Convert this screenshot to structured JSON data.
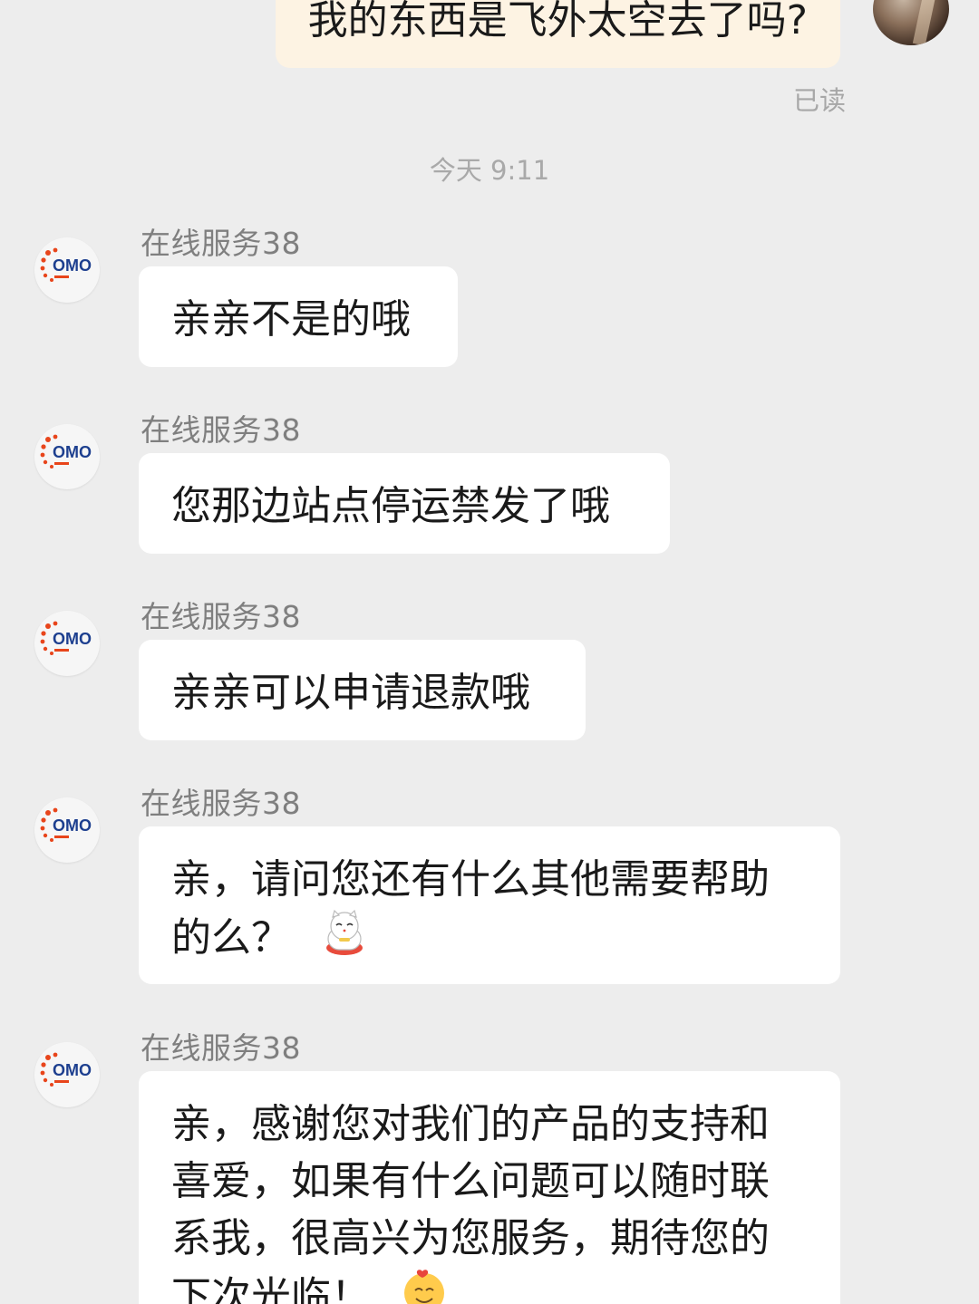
{
  "outgoing": {
    "text": "我的东西是飞外太空去了吗?",
    "status": "已读"
  },
  "timestamp": "今天 9:11",
  "messages": [
    {
      "sender": "在线服务38",
      "text": "亲亲不是的哦",
      "emoji": ""
    },
    {
      "sender": "在线服务38",
      "text": "您那边站点停运禁发了哦",
      "emoji": ""
    },
    {
      "sender": "在线服务38",
      "text": "亲亲可以申请退款哦",
      "emoji": ""
    },
    {
      "sender": "在线服务38",
      "text": "亲，请问您还有什么其他需要帮助的么？",
      "emoji": "lucky-cat-icon"
    },
    {
      "sender": "在线服务38",
      "text": "亲，感谢您对我们的产品的支持和喜爱，如果有什么问题可以随时联系我，很高兴为您服务，期待您的下次光临！",
      "emoji": "smiling-face-with-hearts-icon"
    }
  ],
  "brand": {
    "logo_text": "OMO",
    "accent": "#e8451b",
    "logo_blue": "#1d3f8f"
  }
}
